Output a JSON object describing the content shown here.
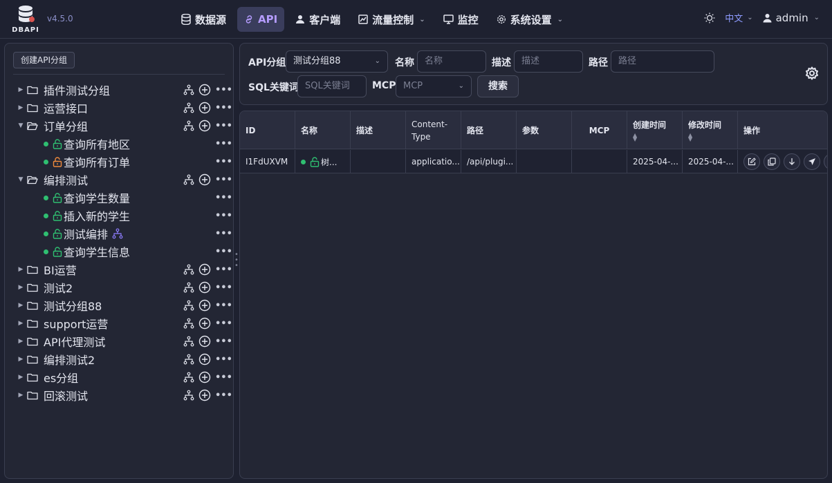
{
  "app": {
    "logo_text": "DBAPI",
    "version": "v4.5.0"
  },
  "nav": {
    "items": [
      {
        "label": "数据源",
        "icon": "database-icon",
        "active": false,
        "dropdown": false
      },
      {
        "label": "API",
        "icon": "link-icon",
        "active": true,
        "dropdown": false
      },
      {
        "label": "客户端",
        "icon": "user-icon",
        "active": false,
        "dropdown": false
      },
      {
        "label": "流量控制",
        "icon": "chart-icon",
        "active": false,
        "dropdown": true
      },
      {
        "label": "监控",
        "icon": "monitor-icon",
        "active": false,
        "dropdown": false
      },
      {
        "label": "系统设置",
        "icon": "settings-icon",
        "active": false,
        "dropdown": true
      }
    ]
  },
  "topright": {
    "language": "中文",
    "user": "admin"
  },
  "sidebar": {
    "create_label": "创建API分组",
    "groups": [
      {
        "label": "插件测试分组",
        "expanded": false,
        "children": []
      },
      {
        "label": "运营接口",
        "expanded": false,
        "children": []
      },
      {
        "label": "订单分组",
        "expanded": true,
        "children": [
          {
            "label": "查询所有地区",
            "lock": "green",
            "flow": false
          },
          {
            "label": "查询所有订单",
            "lock": "orange",
            "flow": false
          }
        ]
      },
      {
        "label": "编排测试",
        "expanded": true,
        "children": [
          {
            "label": "查询学生数量",
            "lock": "green",
            "flow": false
          },
          {
            "label": "插入新的学生",
            "lock": "green",
            "flow": false
          },
          {
            "label": "测试编排",
            "lock": "green",
            "flow": true
          },
          {
            "label": "查询学生信息",
            "lock": "green",
            "flow": false
          }
        ]
      },
      {
        "label": "BI运营",
        "expanded": false,
        "children": []
      },
      {
        "label": "测试2",
        "expanded": false,
        "children": []
      },
      {
        "label": "测试分组88",
        "expanded": false,
        "children": []
      },
      {
        "label": "support运营",
        "expanded": false,
        "children": []
      },
      {
        "label": "API代理测试",
        "expanded": false,
        "children": []
      },
      {
        "label": "编排测试2",
        "expanded": false,
        "children": []
      },
      {
        "label": "es分组",
        "expanded": false,
        "children": []
      },
      {
        "label": "回滚测试",
        "expanded": false,
        "children": []
      }
    ]
  },
  "filters": {
    "group_label": "API分组",
    "group_value": "测试分组88",
    "name_label": "名称",
    "name_placeholder": "名称",
    "desc_label": "描述",
    "desc_placeholder": "描述",
    "path_label": "路径",
    "path_placeholder": "路径",
    "sql_label": "SQL关键词",
    "sql_placeholder": "SQL关键词",
    "mcp_label": "MCP",
    "mcp_placeholder": "MCP",
    "search_label": "搜索"
  },
  "table": {
    "headers": {
      "id": "ID",
      "name": "名称",
      "desc": "描述",
      "content_type_1": "Content-",
      "content_type_2": "Type",
      "path": "路径",
      "params": "参数",
      "mcp": "MCP",
      "created": "创建时间",
      "modified": "修改时间",
      "ops": "操作"
    },
    "rows": [
      {
        "id": "I1FdUXVM",
        "name": "树...",
        "desc": "",
        "content_type": "applicatio...",
        "path": "/api/plugi...",
        "params": "",
        "mcp": "",
        "created": "2025-04-...",
        "modified": "2025-04-..."
      }
    ]
  },
  "colors": {
    "accent": "#b59cff",
    "online": "#2fbf71",
    "lock_open": "#2fbf71",
    "lock_warn": "#f08a3c"
  }
}
